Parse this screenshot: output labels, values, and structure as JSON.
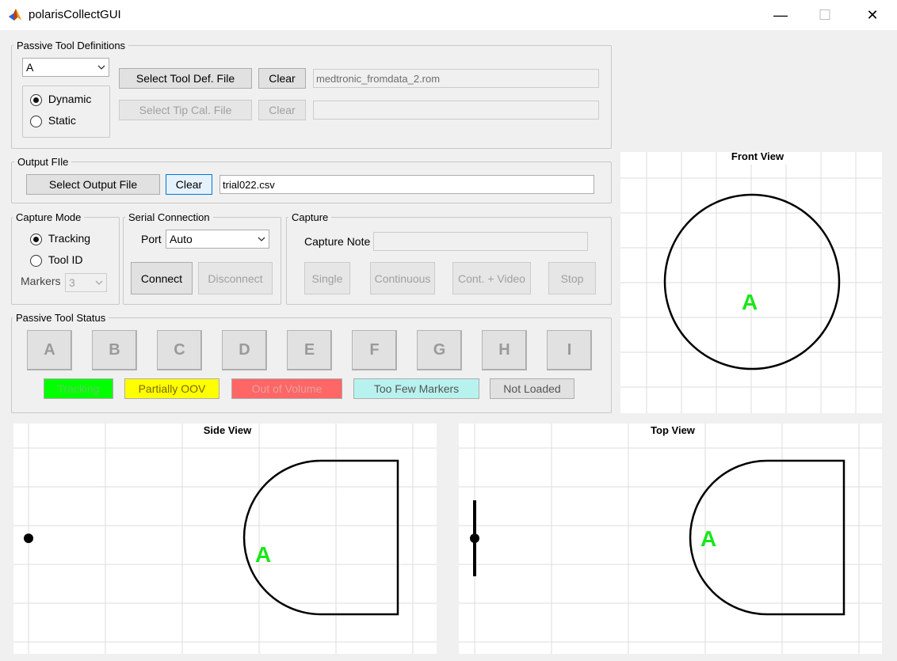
{
  "window": {
    "title": "polarisCollectGUI",
    "min": "—",
    "max": "☐",
    "close": "✕"
  },
  "passive_tool_defs": {
    "title": "Passive Tool Definitions",
    "tool_select": "A",
    "dynamic_label": "Dynamic",
    "static_label": "Static",
    "select_tool_def_label": "Select Tool Def. File",
    "clear_label": "Clear",
    "tool_def_file": "medtronic_fromdata_2.rom",
    "select_tip_cal_label": "Select Tip Cal. File",
    "clear2_label": "Clear",
    "tip_cal_file": ""
  },
  "output_file": {
    "title": "Output FIle",
    "select_label": "Select Output File",
    "clear_label": "Clear",
    "value": "trial022.csv"
  },
  "capture_mode": {
    "title": "Capture Mode",
    "tracking_label": "Tracking",
    "toolid_label": "Tool ID",
    "markers_label": "Markers",
    "markers_value": "3"
  },
  "serial": {
    "title": "Serial Connection",
    "port_label": "Port",
    "port_value": "Auto",
    "connect_label": "Connect",
    "disconnect_label": "Disconnect"
  },
  "capture": {
    "title": "Capture",
    "note_label": "Capture Note",
    "note_value": "",
    "single_label": "Single",
    "continuous_label": "Continuous",
    "cont_video_label": "Cont. + Video",
    "stop_label": "Stop"
  },
  "tool_status": {
    "title": "Passive Tool Status",
    "tools": [
      "A",
      "B",
      "C",
      "D",
      "E",
      "F",
      "G",
      "H",
      "I"
    ],
    "legend": [
      {
        "label": "Tracking",
        "color": "#00ff00",
        "text_color": "#5bd05b"
      },
      {
        "label": "Partially OOV",
        "color": "#ffff00",
        "text_color": "#7a6a00"
      },
      {
        "label": "Out of Volume",
        "color": "#ff6666",
        "text_color": "#e8a0a0"
      },
      {
        "label": "Too Few Markers",
        "color": "#b8f2ef",
        "text_color": "#555555"
      },
      {
        "label": "Not Loaded",
        "color": "#e1e1e1",
        "text_color": "#555555"
      }
    ]
  },
  "front_view": {
    "title": "Front View",
    "tool_label": "A"
  },
  "side_view": {
    "title": "Side View",
    "tool_label": "A"
  },
  "top_view": {
    "title": "Top View",
    "tool_label": "A"
  },
  "colors": {
    "tool_label": "#19e619",
    "grid": "#dcdcdc",
    "accent": "#0078d7"
  }
}
